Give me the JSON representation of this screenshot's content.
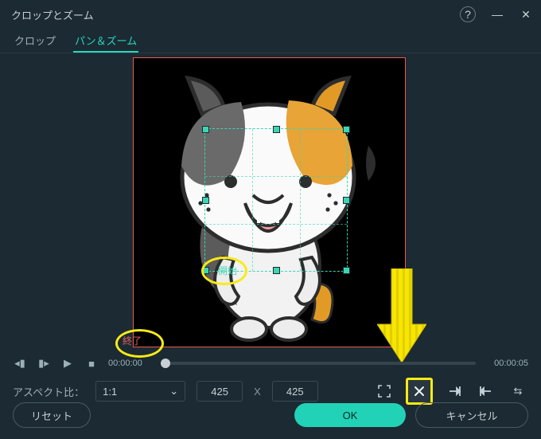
{
  "window": {
    "title": "クロップとズーム"
  },
  "tabs": {
    "crop": "クロップ",
    "panzoom": "パン＆ズーム"
  },
  "crop": {
    "start_label": "開始",
    "end_label": "終了"
  },
  "playback": {
    "current": "00:00:00",
    "total": "00:00:05"
  },
  "aspect": {
    "label": "アスペクト比：",
    "selected": "1:1",
    "width": "425",
    "sep": "X",
    "height": "425"
  },
  "footer": {
    "reset": "リセット",
    "ok": "OK",
    "cancel": "キャンセル"
  },
  "icons": {
    "help": "?",
    "chevron_down": "⌄",
    "minimize": "—",
    "close": "✕",
    "step_back": "◂▮",
    "step_fwd": "▮▸",
    "play": "▶",
    "stop": "■",
    "swap": "⇆"
  }
}
